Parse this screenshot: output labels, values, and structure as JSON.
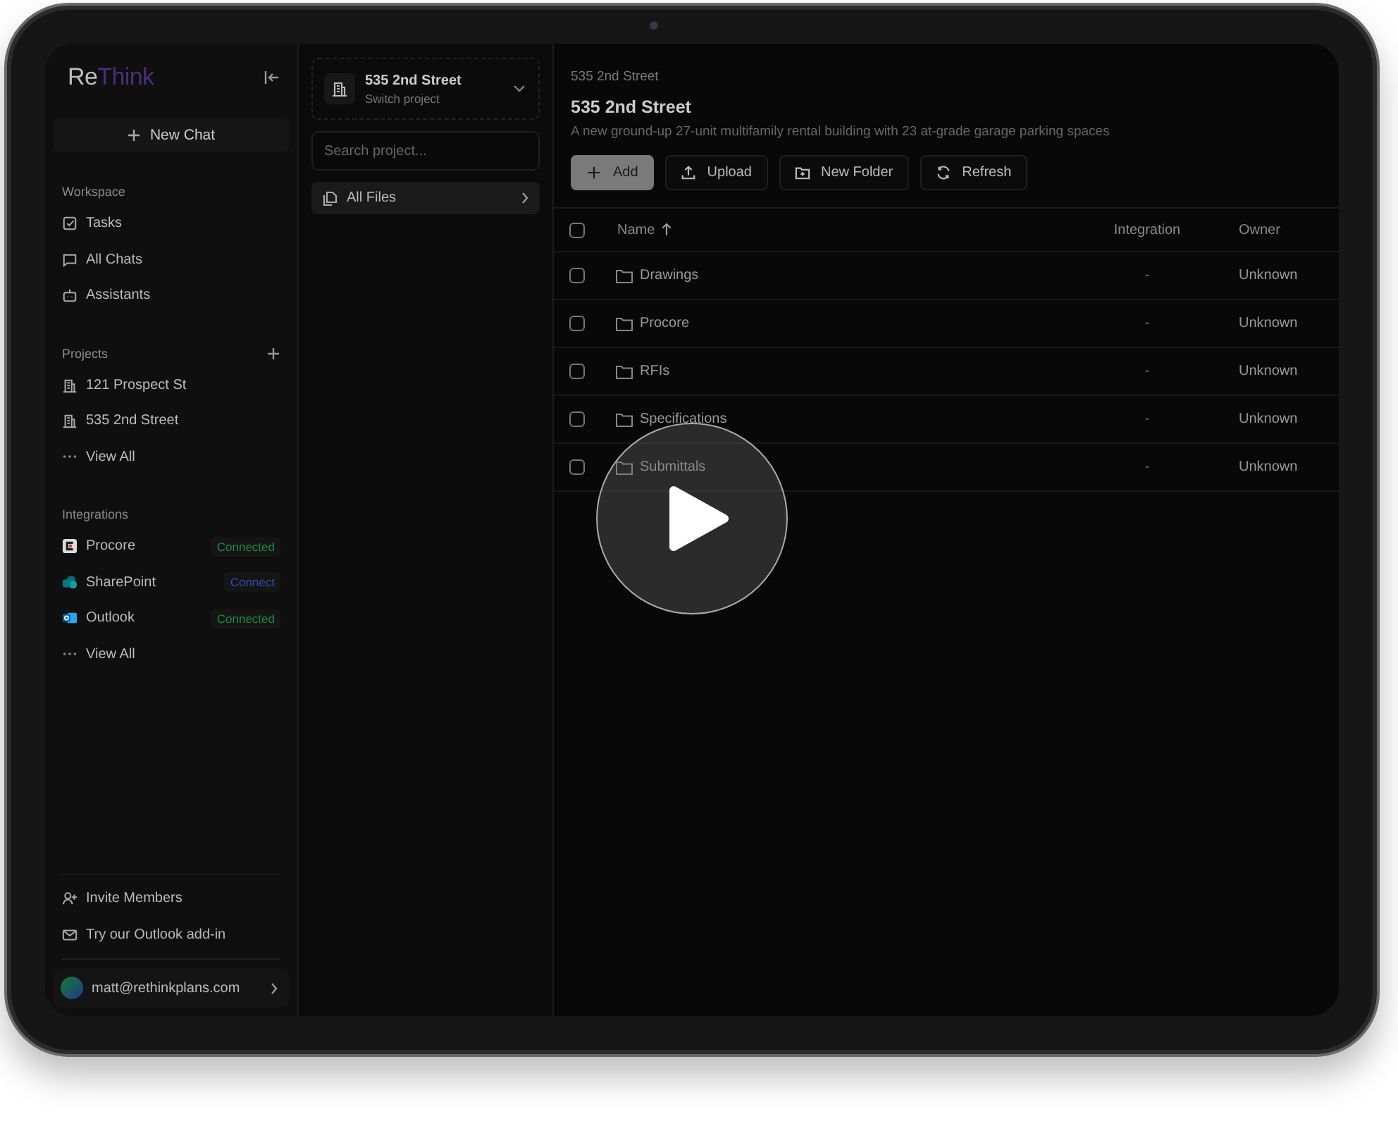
{
  "sidebar": {
    "logo": {
      "main": "Re",
      "accent": "Think"
    },
    "new_chat": "New Chat",
    "sections": [
      {
        "title": "Workspace",
        "add": false,
        "items": [
          {
            "label": "Tasks"
          },
          {
            "label": "All Chats"
          },
          {
            "label": "Assistants"
          }
        ]
      },
      {
        "title": "Projects",
        "add": true,
        "items": [
          {
            "label": "121 Prospect St"
          },
          {
            "label": "535 2nd Street"
          },
          {
            "label": "View All"
          }
        ]
      },
      {
        "title": "Integrations",
        "add": false,
        "items": [
          {
            "label": "Procore",
            "badge": "Connected",
            "color": "#1f8a3e"
          },
          {
            "label": "SharePoint",
            "badge": "Connect",
            "color": "#2a4fb0"
          },
          {
            "label": "Outlook",
            "badge": "Connected",
            "color": "#1f8a3e"
          },
          {
            "label": "View All"
          }
        ]
      }
    ],
    "footer": [
      {
        "label": "Invite Members"
      },
      {
        "label": "Try our Outlook add-in"
      }
    ],
    "user": {
      "email": "matt@rethinkplans.com"
    }
  },
  "project_panel": {
    "project": {
      "name": "535 2nd Street",
      "subtitle": "Switch project"
    },
    "search": {
      "placeholder": "Search project..."
    },
    "nav": [
      {
        "label": "All Files",
        "selected": true
      }
    ]
  },
  "main": {
    "breadcrumb": "535 2nd Street",
    "title": "535 2nd Street",
    "description": "A new ground-up 27-unit multifamily rental building with 23 at-grade garage parking spaces",
    "actions": [
      {
        "label": "Add",
        "primary": true
      },
      {
        "label": "Upload",
        "primary": false
      },
      {
        "label": "New Folder",
        "primary": false
      },
      {
        "label": "Refresh",
        "primary": false
      }
    ],
    "table": {
      "header_checked": false,
      "columns": [
        "Name",
        "Integration",
        "Owner"
      ],
      "rows": [
        {
          "checked": false,
          "name": "Drawings",
          "integration": "-",
          "owner": "Unknown"
        },
        {
          "checked": false,
          "name": "Procore",
          "integration": "-",
          "owner": "Unknown"
        },
        {
          "checked": false,
          "name": "RFIs",
          "integration": "-",
          "owner": "Unknown"
        },
        {
          "checked": false,
          "name": "Specifications",
          "integration": "-",
          "owner": "Unknown"
        },
        {
          "checked": false,
          "name": "Submittals",
          "integration": "-",
          "owner": "Unknown"
        }
      ]
    }
  }
}
